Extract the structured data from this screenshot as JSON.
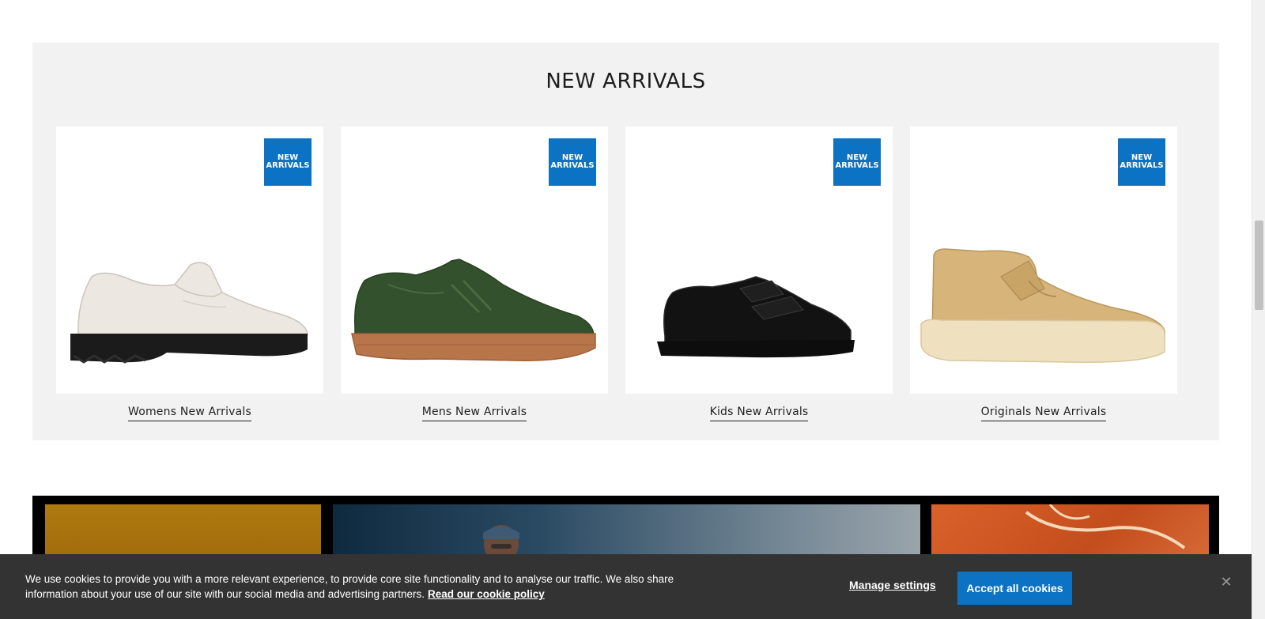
{
  "arrivals": {
    "title": "NEW ARRIVALS",
    "cards": [
      {
        "badge": "NEW ARRIVALS",
        "link": "Womens New Arrivals"
      },
      {
        "badge": "NEW ARRIVALS",
        "link": "Mens New Arrivals"
      },
      {
        "badge": "NEW ARRIVALS",
        "link": "Kids New Arrivals"
      },
      {
        "badge": "NEW ARRIVALS",
        "link": "Originals New Arrivals"
      }
    ]
  },
  "cookie_bar": {
    "message": "We use cookies to provide you with a more relevant experience, to provide core site functionality and to analyse our traffic. We also share information about your use of our site with our social media and advertising partners.",
    "policy_link": "Read our cookie policy",
    "manage_label": "Manage settings",
    "accept_label": "Accept all cookies",
    "close_icon": "close-icon"
  },
  "colors": {
    "accent": "#0b72c4",
    "section_bg": "#f2f2f2",
    "cookie_bg": "#333333"
  }
}
